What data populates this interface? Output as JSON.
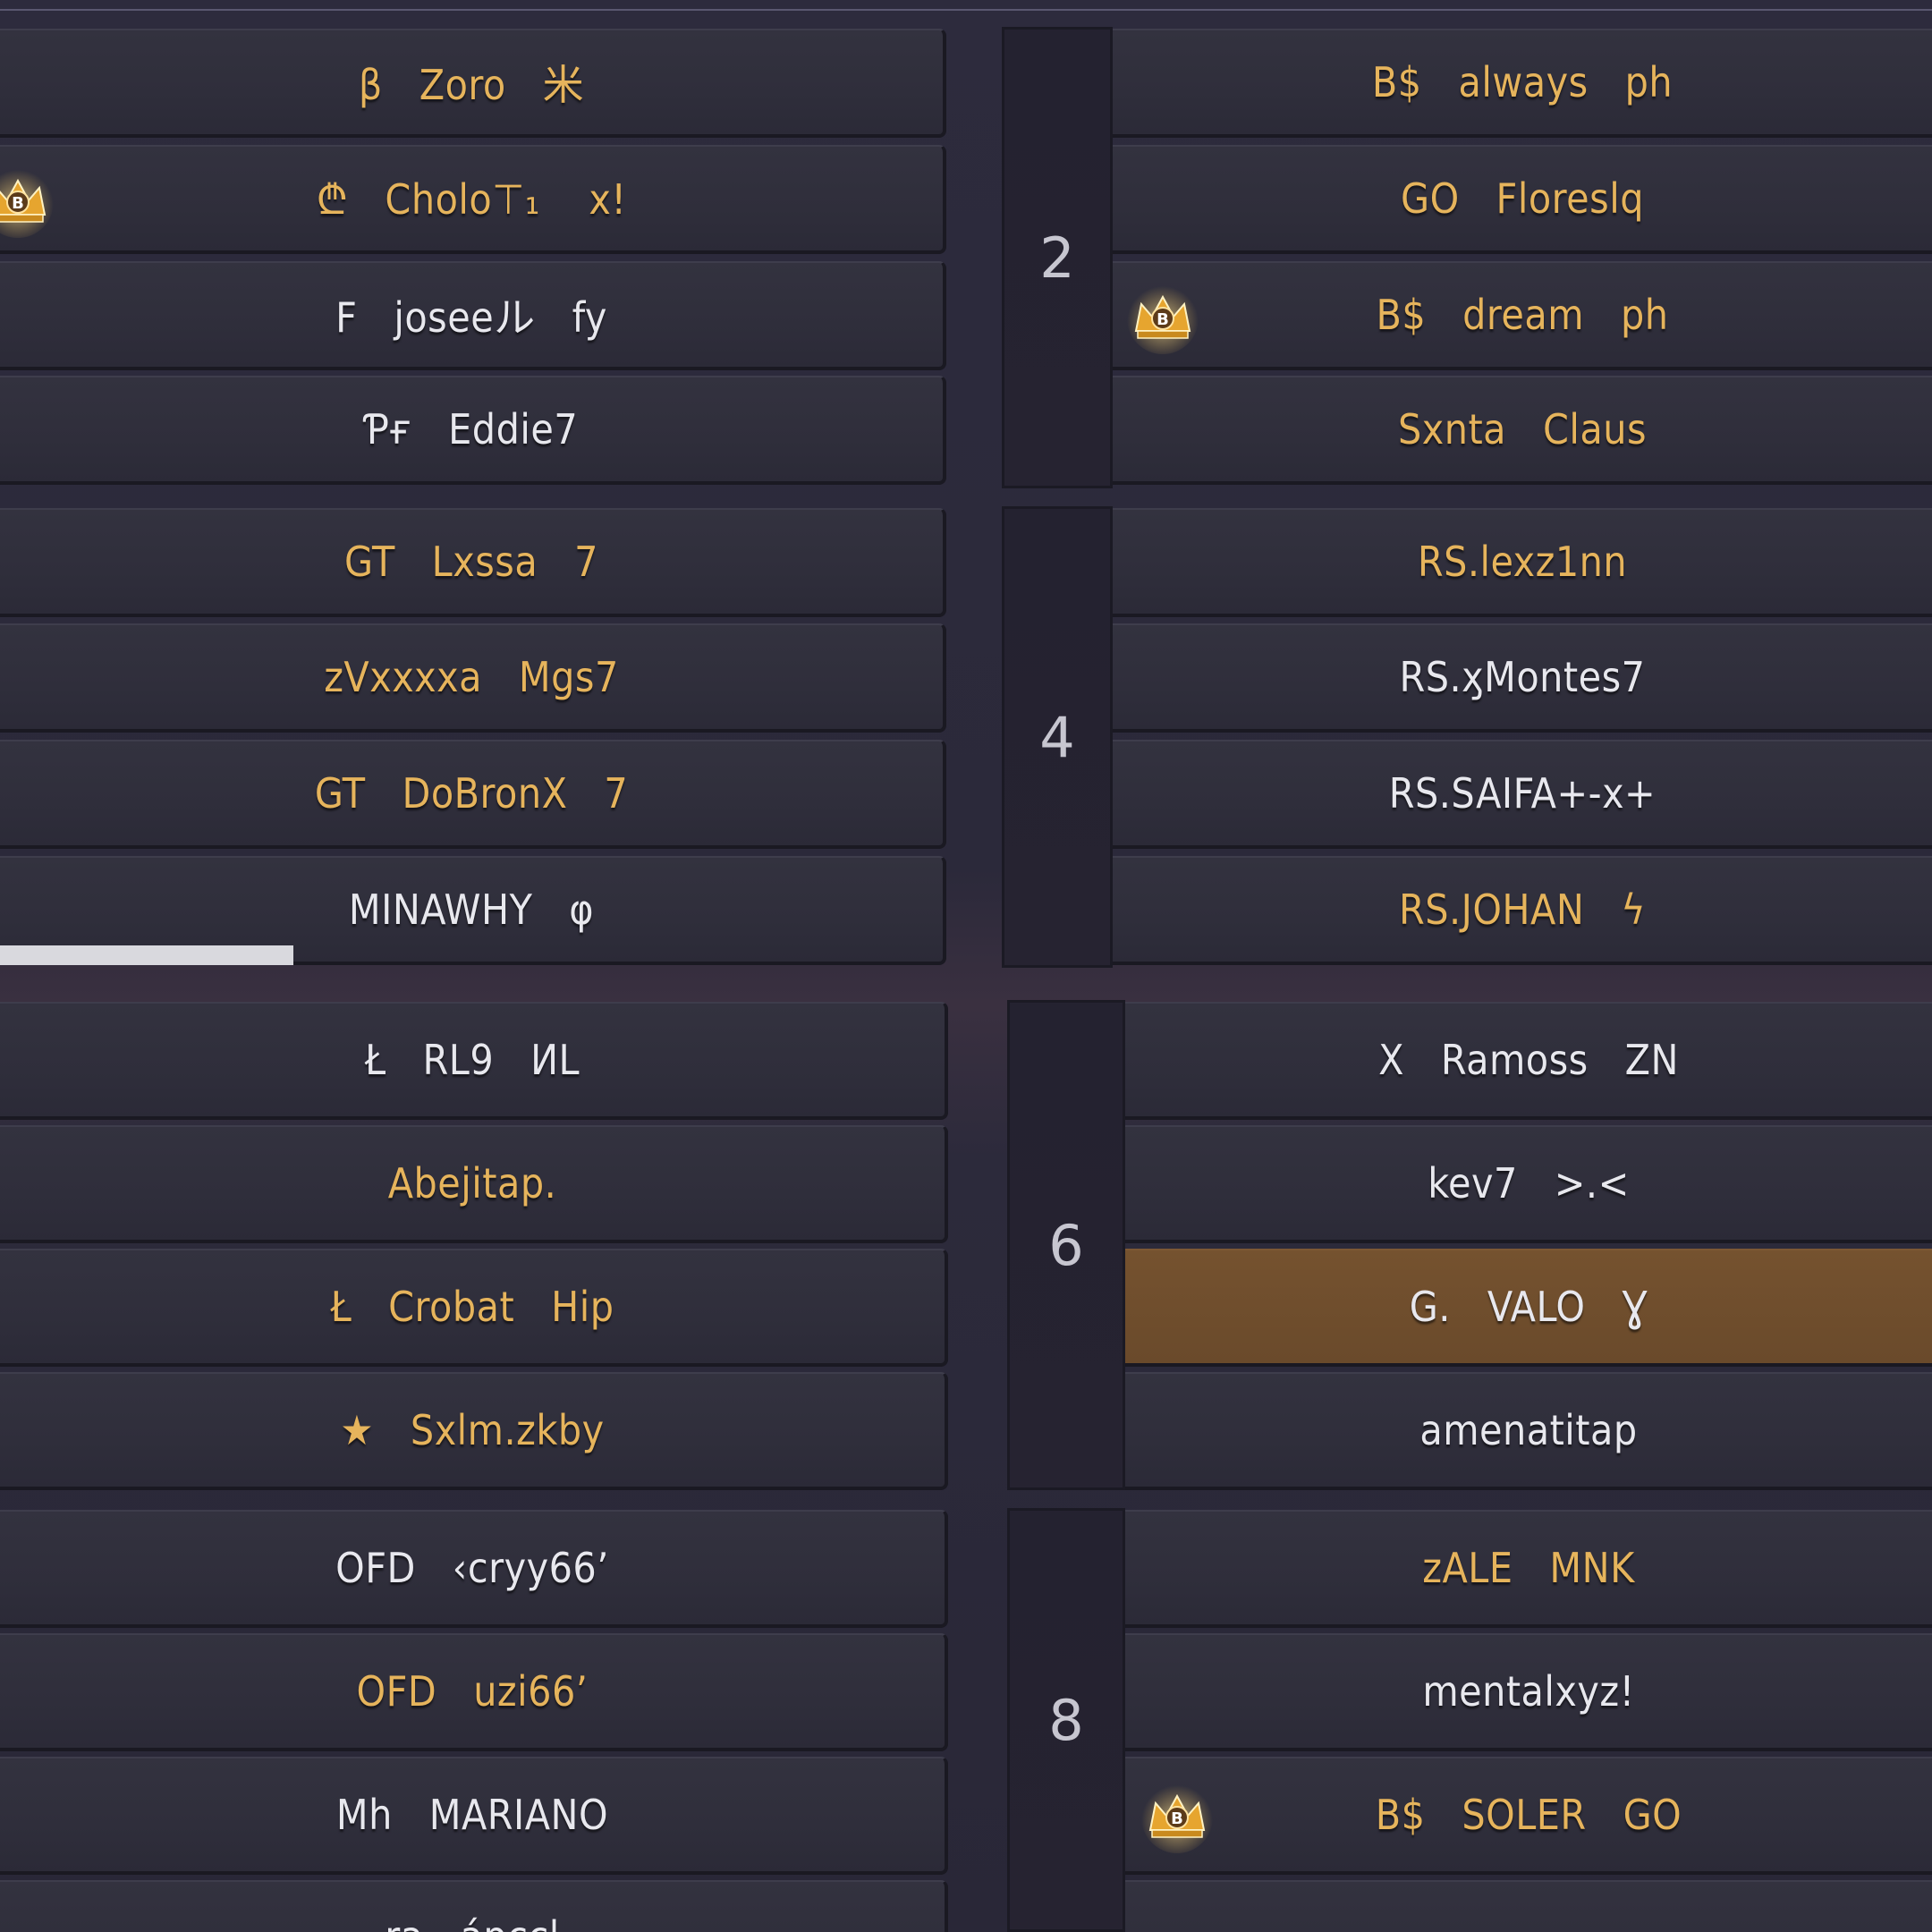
{
  "groups": {
    "g2": "2",
    "g4": "4",
    "g6": "6",
    "g8": "8"
  },
  "left_col_a": [
    {
      "text": "β   Zoro   米",
      "style": "gold"
    },
    {
      "text": "₾   Cholo⊤₁    x!",
      "style": "gold"
    },
    {
      "text": "F   joseeル   fy",
      "style": "white"
    },
    {
      "text": "Ƥғ   Eddie7",
      "style": "white"
    }
  ],
  "left_col_b": [
    {
      "text": "GT   Lxssa   7",
      "style": "gold"
    },
    {
      "text": "zVxxxxa   Mgs7",
      "style": "gold"
    },
    {
      "text": "GT   DoBronX   7",
      "style": "gold"
    },
    {
      "text": "MINAWHY   φ",
      "style": "white"
    }
  ],
  "left_col_c": [
    {
      "text": "Ł   RL9   ИL",
      "style": "white"
    },
    {
      "text": "Abejitap.",
      "style": "gold"
    },
    {
      "text": "Ł   Crobat   Hip",
      "style": "gold"
    },
    {
      "text": "★   Sxlm.zkby",
      "style": "gold"
    }
  ],
  "left_col_d": [
    {
      "text": "OFD   ‹cryy66’",
      "style": "white"
    },
    {
      "text": "OFD   uzi66’",
      "style": "gold"
    },
    {
      "text": "Mh   MARIANO",
      "style": "white"
    },
    {
      "text": "ra   ápccl",
      "style": "white"
    }
  ],
  "right_col_2": [
    {
      "text": "B$   always   ph",
      "style": "gold"
    },
    {
      "text": "GO   Floreslq",
      "style": "gold"
    },
    {
      "text": "B$   dream   ph",
      "style": "gold"
    },
    {
      "text": "Sxnta   Claus",
      "style": "gold"
    }
  ],
  "right_col_4": [
    {
      "text": "RS.lexz1nn",
      "style": "gold"
    },
    {
      "text": "RS.ӽMontes7",
      "style": "white"
    },
    {
      "text": "RS.SAIFA+-x+",
      "style": "white"
    },
    {
      "text": "RS.JOHAN   ϟ",
      "style": "gold"
    }
  ],
  "right_col_6": [
    {
      "text": "X   Ramoss   ZN",
      "style": "white"
    },
    {
      "text": "kev7   >.<",
      "style": "white"
    },
    {
      "text": "G.   VALO   Ɣ",
      "style": "white"
    },
    {
      "text": "amenatitap",
      "style": "white"
    }
  ],
  "right_col_8": [
    {
      "text": "zALE   MNK",
      "style": "gold"
    },
    {
      "text": "mentalxyz!",
      "style": "white"
    },
    {
      "text": "B$   SOLER   GO",
      "style": "gold"
    }
  ],
  "badges": {
    "icon": "crown-badge-icon",
    "label": "B"
  },
  "colors": {
    "gold": "#e6b45c",
    "white": "#e8e8ee",
    "highlight": "#6e4e2d",
    "panel": "#2f2e3b"
  },
  "match_progress": {
    "fraction": 0.31
  }
}
